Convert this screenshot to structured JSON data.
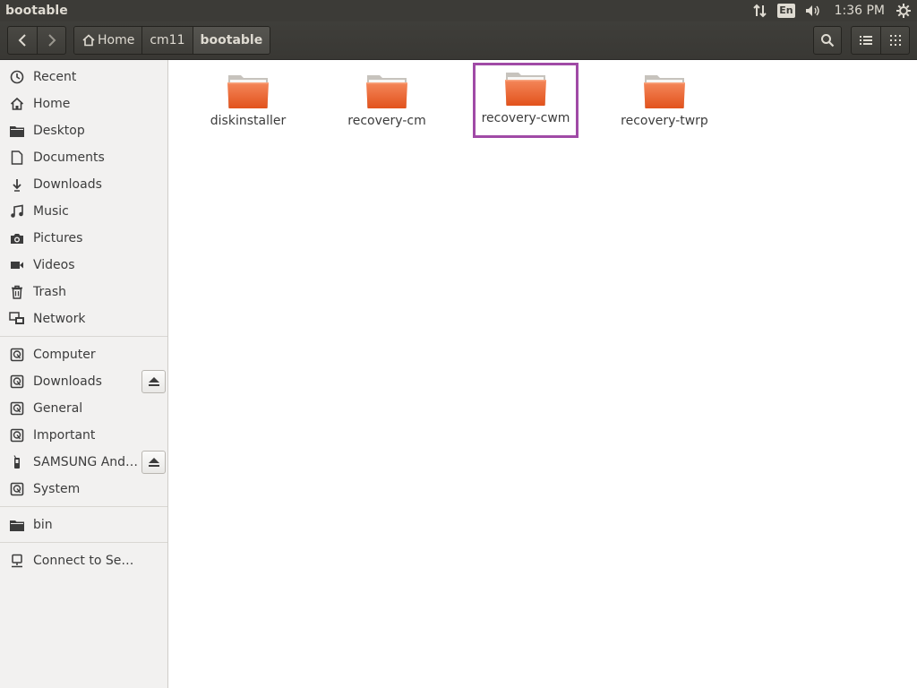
{
  "window": {
    "title": "bootable"
  },
  "panel": {
    "lang": "En",
    "clock": "1:36 PM"
  },
  "breadcrumb": [
    {
      "label": "Home"
    },
    {
      "label": "cm11"
    },
    {
      "label": "bootable"
    }
  ],
  "sidebar": {
    "places": [
      {
        "label": "Recent",
        "icon": "clock-icon"
      },
      {
        "label": "Home",
        "icon": "home-icon"
      },
      {
        "label": "Desktop",
        "icon": "folder-icon"
      },
      {
        "label": "Documents",
        "icon": "document-icon"
      },
      {
        "label": "Downloads",
        "icon": "download-icon"
      },
      {
        "label": "Music",
        "icon": "music-icon"
      },
      {
        "label": "Pictures",
        "icon": "camera-icon"
      },
      {
        "label": "Videos",
        "icon": "video-icon"
      },
      {
        "label": "Trash",
        "icon": "trash-icon"
      },
      {
        "label": "Network",
        "icon": "network-icon"
      }
    ],
    "devices": [
      {
        "label": "Computer",
        "icon": "drive-icon",
        "eject": false
      },
      {
        "label": "Downloads",
        "icon": "drive-icon",
        "eject": true
      },
      {
        "label": "General",
        "icon": "drive-icon",
        "eject": false
      },
      {
        "label": "Important",
        "icon": "drive-icon",
        "eject": false
      },
      {
        "label": "SAMSUNG Android",
        "icon": "phone-icon",
        "eject": true
      },
      {
        "label": "System",
        "icon": "drive-icon",
        "eject": false
      }
    ],
    "bookmarks": [
      {
        "label": "bin",
        "icon": "folder-icon"
      }
    ],
    "network": [
      {
        "label": "Connect to Server",
        "icon": "server-icon"
      }
    ]
  },
  "files": [
    {
      "name": "diskinstaller",
      "selected": false
    },
    {
      "name": "recovery-cm",
      "selected": false
    },
    {
      "name": "recovery-cwm",
      "selected": true
    },
    {
      "name": "recovery-twrp",
      "selected": false
    }
  ],
  "colors": {
    "panel_bg": "#3c3b37",
    "folder_orange": "#e95420",
    "selection_outline": "#a04aa6",
    "sidebar_bg": "#f2f1f0"
  }
}
